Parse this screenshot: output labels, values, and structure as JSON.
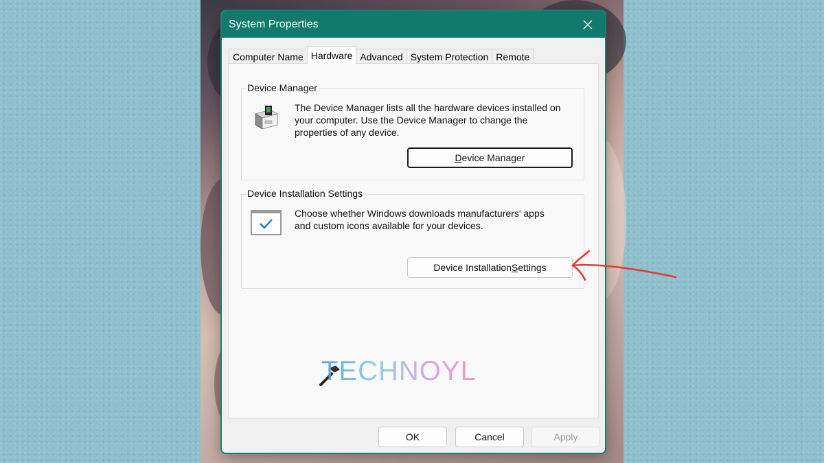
{
  "window": {
    "title": "System Properties",
    "close_icon": "close-icon"
  },
  "tabs": [
    {
      "label": "Computer Name",
      "active": false
    },
    {
      "label": "Hardware",
      "active": true
    },
    {
      "label": "Advanced",
      "active": false
    },
    {
      "label": "System Protection",
      "active": false
    },
    {
      "label": "Remote",
      "active": false
    }
  ],
  "device_manager": {
    "group_label": "Device Manager",
    "description": "The Device Manager lists all the hardware devices installed on your computer. Use the Device Manager to change the properties of any device.",
    "description_lines": [
      "The Device Manager lists all the hardware devices installed on",
      "your computer. Use the Device Manager to change the",
      "properties of any device."
    ],
    "button_label_pre": "",
    "button_label_accel": "D",
    "button_label_post": "evice Manager",
    "icon": "device-manager-icon"
  },
  "device_installation": {
    "group_label": "Device Installation Settings",
    "description_lines": [
      "Choose whether Windows downloads manufacturers' apps",
      "and custom icons available for your devices."
    ],
    "button_label_pre": "Device Installation ",
    "button_label_accel": "S",
    "button_label_post": "ettings",
    "icon": "checkbox-window-icon"
  },
  "watermark": {
    "text": "TECHNOYL",
    "icon": "hammer-icon"
  },
  "footer": {
    "ok_label": "OK",
    "cancel_label": "Cancel",
    "apply_label": "Apply"
  },
  "annotation": {
    "arrow_icon": "red-arrow-icon",
    "color": "#e53935"
  },
  "colors": {
    "titlebar": "#117a6c",
    "accent_border": "#1d7f72",
    "check": "#1a73c7"
  }
}
